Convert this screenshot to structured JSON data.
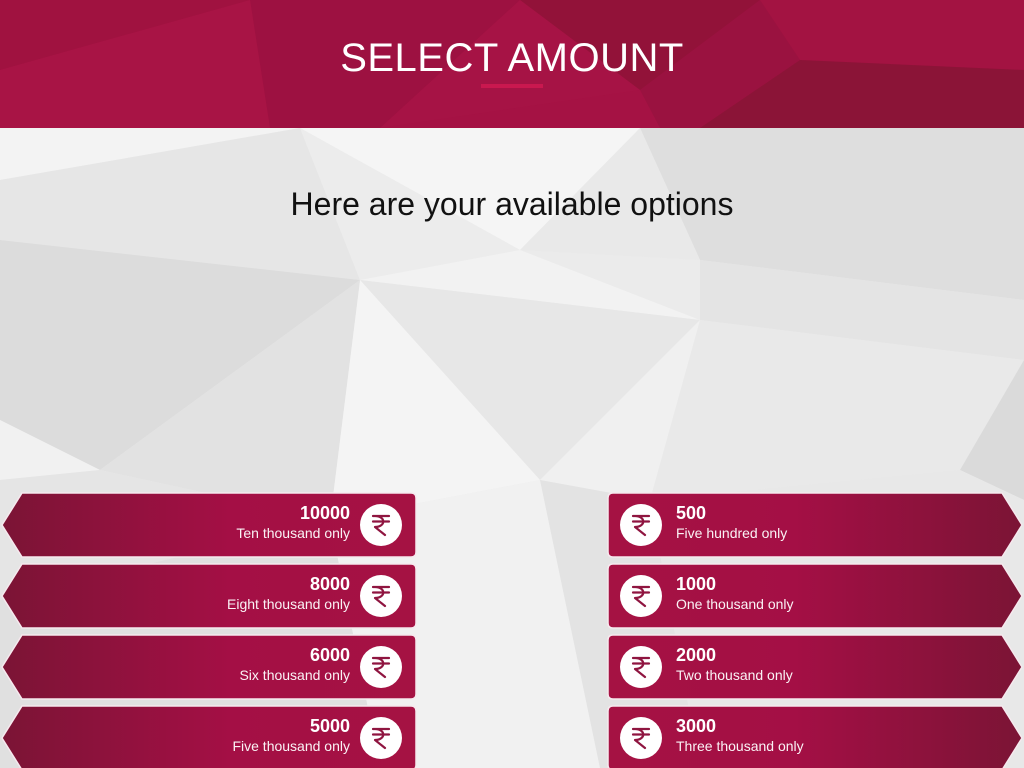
{
  "header": {
    "title": "SELECT AMOUNT"
  },
  "main": {
    "subtitle": "Here are your available options"
  },
  "colors": {
    "brand": "#a51243",
    "brand_dark": "#7e1436",
    "accent": "#c9184f"
  },
  "icons": {
    "currency": "rupee-icon"
  },
  "options_left": [
    {
      "amount": "10000",
      "words": "Ten thousand only"
    },
    {
      "amount": "8000",
      "words": "Eight thousand only"
    },
    {
      "amount": "6000",
      "words": "Six thousand only"
    },
    {
      "amount": "5000",
      "words": "Five thousand only"
    }
  ],
  "options_right": [
    {
      "amount": "500",
      "words": "Five hundred only"
    },
    {
      "amount": "1000",
      "words": "One thousand only"
    },
    {
      "amount": "2000",
      "words": "Two thousand only"
    },
    {
      "amount": "3000",
      "words": "Three thousand only"
    }
  ]
}
